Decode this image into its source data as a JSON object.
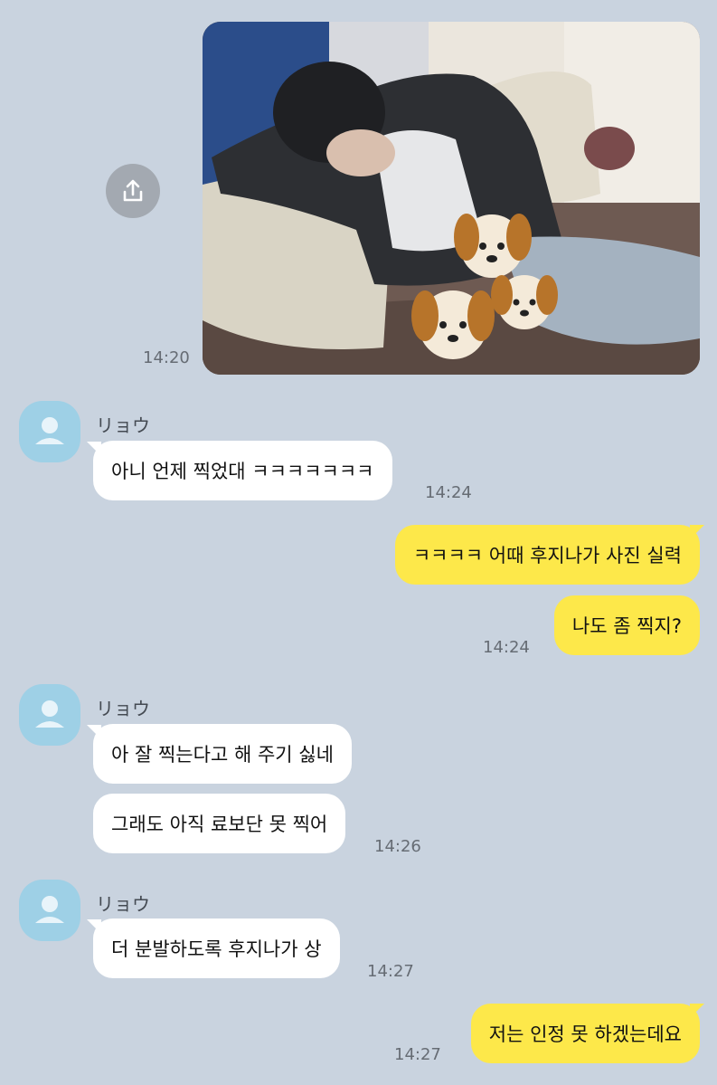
{
  "colors": {
    "background": "#c9d3df",
    "incoming_bubble": "#ffffff",
    "outgoing_bubble": "#fde84a",
    "avatar": "#9ed0e6"
  },
  "photo_message": {
    "time": "14:20",
    "share_icon": "share-icon"
  },
  "groups": [
    {
      "sender": "リョウ",
      "messages": [
        "아니 언제 찍었대 ㅋㅋㅋㅋㅋㅋㅋ"
      ],
      "time": "14:24"
    },
    {
      "sender": "リョウ",
      "messages": [
        "아 잘 찍는다고 해 주기 싫네",
        "그래도 아직 료보단 못 찍어"
      ],
      "time": "14:26"
    },
    {
      "sender": "リョウ",
      "messages": [
        "더 분발하도록 후지나가 상"
      ],
      "time": "14:27"
    }
  ],
  "outgoing": [
    {
      "messages": [
        "ㅋㅋㅋㅋ 어때 후지나가 사진 실력",
        "나도 좀 찍지?"
      ],
      "time": "14:24"
    },
    {
      "messages": [
        "저는 인정 못 하겠는데요"
      ],
      "time": "14:27"
    }
  ]
}
